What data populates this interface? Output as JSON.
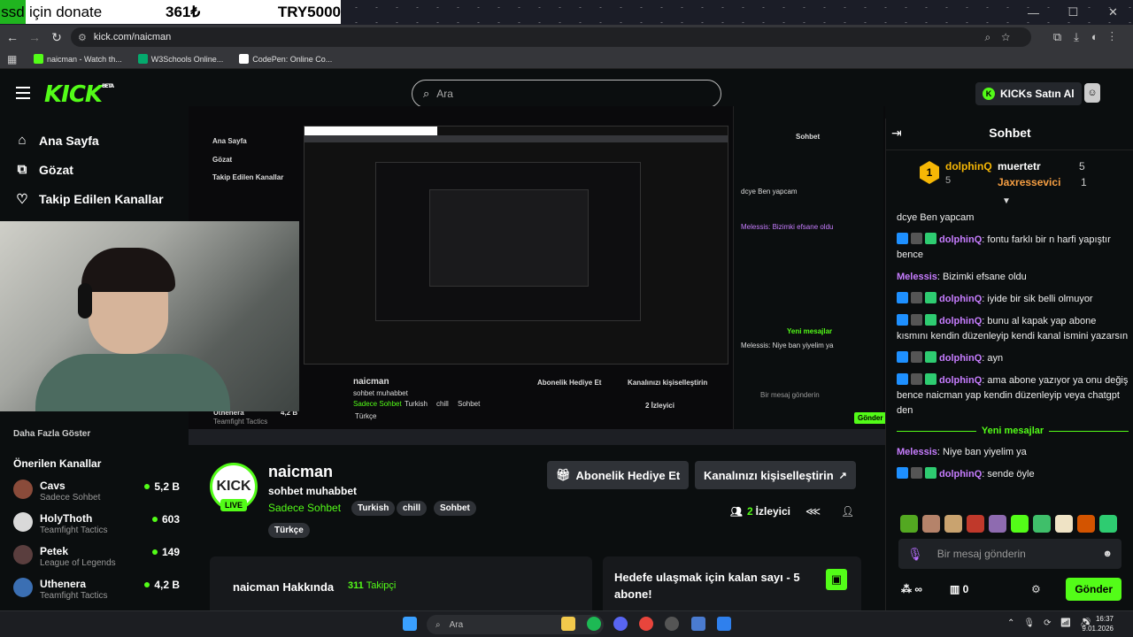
{
  "donation_overlay": {
    "badge": "ssd",
    "text": "için donate",
    "amount": "361₺",
    "goal": "TRY5000"
  },
  "browser": {
    "url": "kick.com/naicman",
    "bookmarks": [
      {
        "label": "naicman - Watch th...",
        "color": "#53fc18"
      },
      {
        "label": "W3Schools Online...",
        "color": "#04aa6d"
      },
      {
        "label": "CodePen: Online Co...",
        "color": "#ffffff"
      }
    ]
  },
  "header": {
    "logo": "KICK",
    "logo_badge": "BETA",
    "search_placeholder": "Ara",
    "buy_ai": "KICKs Satın Al"
  },
  "sidebar": {
    "nav": [
      {
        "icon": "⌂",
        "label": "Ana Sayfa"
      },
      {
        "icon": "⧉",
        "label": "Gözat"
      },
      {
        "icon": "♡",
        "label": "Takip Edilen Kanallar"
      }
    ],
    "show_more": "Daha Fazla Göster",
    "recommended_title": "Önerilen Kanallar",
    "channels": [
      {
        "name": "Cavs",
        "category": "Sadece Sohbet",
        "viewers": "5,2 B",
        "color": "#8a4b3a"
      },
      {
        "name": "HolyThoth",
        "category": "Teamfight Tactics",
        "viewers": "603",
        "color": "#d9d9d9"
      },
      {
        "name": "Petek",
        "category": "League of Legends",
        "viewers": "149",
        "color": "#5a3e3e"
      },
      {
        "name": "Uthenera",
        "category": "Teamfight Tactics",
        "viewers": "4,2 B",
        "color": "#3b6fb3"
      }
    ]
  },
  "stream_mirror": {
    "nav": [
      "Ana Sayfa",
      "Gözat",
      "Takip Edilen Kanallar"
    ],
    "channel": "naicman",
    "title": "sohbet muhabbet",
    "category": "Sadece Sohbet",
    "tags": [
      "Turkish",
      "chill",
      "Sohbet",
      "Türkçe"
    ],
    "sub_gift": "Abonelik Hediye Et",
    "customize": "Kanalınızı kişiselleştirin",
    "viewers": "2 İzleyici",
    "chat_title": "Sohbet",
    "side_channel": "Uthenera",
    "side_category": "Teamfight Tactics",
    "side_viewers": "4,2 B",
    "input_placeholder": "Bir mesaj gönderin",
    "send": "Gönder",
    "lines": [
      "dcye Ben yapcam",
      "Melessis: Bizimki efsane oldu",
      "Yeni mesajlar",
      "Melessis: Niye ban yiyelim ya"
    ]
  },
  "channel": {
    "name": "naicman",
    "avatar_text": "KICK",
    "live_label": "LIVE",
    "title": "sohbet muhabbet",
    "category": "Sadece Sohbet",
    "tags": [
      "Turkish",
      "chill",
      "Sohbet",
      "Türkçe"
    ],
    "gift_sub_button": "Abonelik Hediye Et",
    "customize_button": "Kanalınızı kişiselleştirin",
    "viewer_count": "2",
    "viewer_label": "İzleyici",
    "about_title": "naicman Hakkında",
    "followers": "311",
    "followers_label": "Takipçi",
    "goal_text": "Hedefe ulaşmak için kalan sayı - 5 abone!"
  },
  "chat": {
    "title": "Sohbet",
    "leaderboard": {
      "first_rank": "1",
      "first": {
        "name": "dolphinQ",
        "count": "5"
      },
      "second": {
        "name": "muertetr",
        "count": "5"
      },
      "third": {
        "name": "Jaxressevici",
        "count": "1"
      }
    },
    "messages": [
      {
        "user": "",
        "user_color": "#ffffff",
        "text": "dcye Ben yapcam",
        "badges": false
      },
      {
        "user": "dolphinQ",
        "user_color": "#c77dff",
        "text": "fontu farklı bir n harfi yapıştır bence",
        "badges": true
      },
      {
        "user": "Melessis",
        "user_color": "#c77dff",
        "text": "Bizimki efsane oldu",
        "badges": false
      },
      {
        "user": "dolphinQ",
        "user_color": "#c77dff",
        "text": "iyide bir sik belli olmuyor",
        "badges": true
      },
      {
        "user": "dolphinQ",
        "user_color": "#c77dff",
        "text": "bunu al kapak yap abone kısmını kendin düzenleyip kendi kanal ismini yazarsın",
        "badges": true
      },
      {
        "user": "dolphinQ",
        "user_color": "#c77dff",
        "text": "ayn",
        "badges": true
      },
      {
        "user": "dolphinQ",
        "user_color": "#c77dff",
        "text": "ama abone yazıyor ya onu değiş bence naicman yap kendin düzenleyip veya chatgpt den",
        "badges": true
      }
    ],
    "new_messages_label": "Yeni mesajlar",
    "new_messages": [
      {
        "user": "Melessis",
        "user_color": "#c77dff",
        "text": "Niye ban yiyelim ya",
        "badges": false
      },
      {
        "user": "dolphinQ",
        "user_color": "#c77dff",
        "text": "sende öyle",
        "badges": true
      }
    ],
    "emote_colors": [
      "#53a821",
      "#b5836a",
      "#c9a36f",
      "#c0392b",
      "#8e6bb0",
      "#53fc18",
      "#3fbf6a",
      "#efe3c5",
      "#d35400",
      "#2ecc71"
    ],
    "input_placeholder": "Bir mesaj gönderin",
    "infinity_label": "∞",
    "gift_count": "0",
    "send_button": "Gönder"
  },
  "taskbar": {
    "search": "Ara",
    "time": "16:37",
    "date": "9.01.2026"
  },
  "colors": {
    "kick_green": "#53fc18",
    "background": "#0b0e0f",
    "chat_purple": "#c77dff"
  }
}
